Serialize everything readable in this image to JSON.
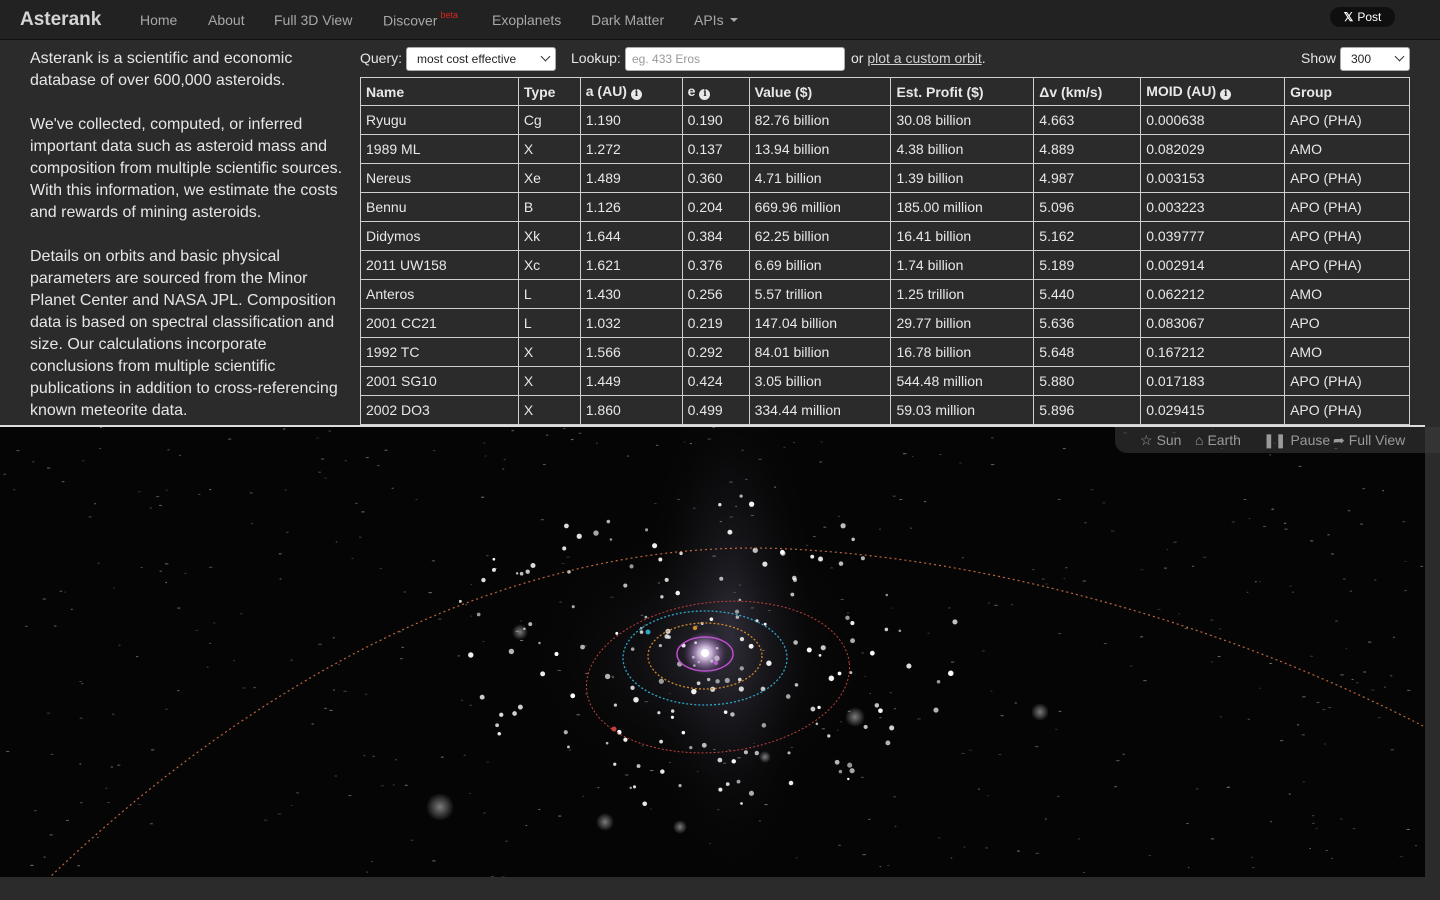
{
  "nav": {
    "brand": "Asterank",
    "items": [
      {
        "label": "Home"
      },
      {
        "label": "About"
      },
      {
        "label": "Full 3D View"
      },
      {
        "label": "Discover",
        "badge": "beta"
      },
      {
        "label": "Exoplanets"
      },
      {
        "label": "Dark Matter"
      },
      {
        "label": "APIs"
      }
    ],
    "post_label": "Post"
  },
  "intro": {
    "p1": "Asterank is a scientific and economic database of over 600,000 asteroids.",
    "p2": "We've collected, computed, or inferred important data such as asteroid mass and composition from multiple scientific sources. With this information, we estimate the costs and rewards of mining asteroids.",
    "p3": "Details on orbits and basic physical parameters are sourced from the Minor Planet Center and NASA JPL. Composition data is based on spectral classification and size. Our calculations incorporate conclusions from multiple scientific publications in addition to cross-referencing known meteorite data."
  },
  "controls": {
    "query_label": "Query:",
    "query_value": "most cost effective",
    "lookup_label": "Lookup:",
    "lookup_placeholder": "eg. 433 Eros",
    "or_text": "or",
    "orbit_link": "plot a custom orbit",
    "period": ".",
    "show_label": "Show",
    "show_value": "300"
  },
  "table": {
    "headers": [
      "Name",
      "Type",
      "a (AU)",
      "e",
      "Value ($)",
      "Est. Profit ($)",
      "Δv (km/s)",
      "MOID (AU)",
      "Group"
    ],
    "rows": [
      [
        "Ryugu",
        "Cg",
        "1.190",
        "0.190",
        "82.76 billion",
        "30.08 billion",
        "4.663",
        "0.000638",
        "APO (PHA)"
      ],
      [
        "1989 ML",
        "X",
        "1.272",
        "0.137",
        "13.94 billion",
        "4.38 billion",
        "4.889",
        "0.082029",
        "AMO"
      ],
      [
        "Nereus",
        "Xe",
        "1.489",
        "0.360",
        "4.71 billion",
        "1.39 billion",
        "4.987",
        "0.003153",
        "APO (PHA)"
      ],
      [
        "Bennu",
        "B",
        "1.126",
        "0.204",
        "669.96 million",
        "185.00 million",
        "5.096",
        "0.003223",
        "APO (PHA)"
      ],
      [
        "Didymos",
        "Xk",
        "1.644",
        "0.384",
        "62.25 billion",
        "16.41 billion",
        "5.162",
        "0.039777",
        "APO (PHA)"
      ],
      [
        "2011 UW158",
        "Xc",
        "1.621",
        "0.376",
        "6.69 billion",
        "1.74 billion",
        "5.189",
        "0.002914",
        "APO (PHA)"
      ],
      [
        "Anteros",
        "L",
        "1.430",
        "0.256",
        "5.57 trillion",
        "1.25 trillion",
        "5.440",
        "0.062212",
        "AMO"
      ],
      [
        "2001 CC21",
        "L",
        "1.032",
        "0.219",
        "147.04 billion",
        "29.77 billion",
        "5.636",
        "0.083067",
        "APO"
      ],
      [
        "1992 TC",
        "X",
        "1.566",
        "0.292",
        "84.01 billion",
        "16.78 billion",
        "5.648",
        "0.167212",
        "AMO"
      ],
      [
        "2001 SG10",
        "X",
        "1.449",
        "0.424",
        "3.05 billion",
        "544.48 million",
        "5.880",
        "0.017183",
        "APO (PHA)"
      ],
      [
        "2002 DO3",
        "X",
        "1.860",
        "0.499",
        "334.44 million",
        "59.03 million",
        "5.896",
        "0.029415",
        "APO (PHA)"
      ]
    ]
  },
  "space_controls": {
    "sun": "Sun",
    "earth": "Earth",
    "pause": "Pause",
    "full_view": "Full View"
  },
  "colors": {
    "navbar_bg": "#222222",
    "page_bg": "#2b2b2b",
    "beta_badge": "#d9261c",
    "orbit_mercury": "#c04cd0",
    "orbit_venus": "#d08a2a",
    "orbit_earth": "#2fa6c8",
    "orbit_mars": "#c0403a",
    "orbit_asteroid": "#e0784a"
  }
}
